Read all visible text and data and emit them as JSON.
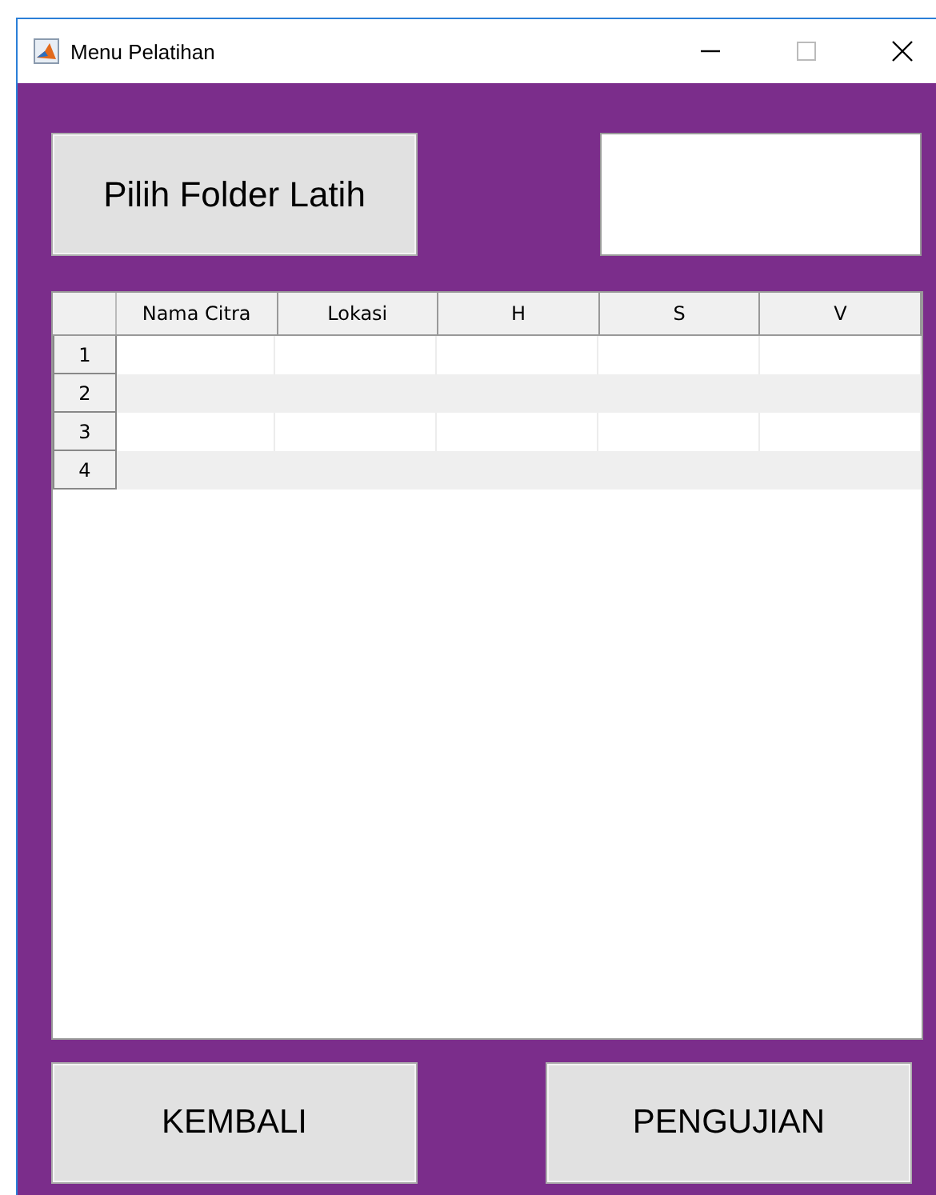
{
  "window": {
    "title": "Menu Pelatihan"
  },
  "folder_button": {
    "label": "Pilih Folder Latih"
  },
  "table": {
    "columns": [
      "Nama Citra",
      "Lokasi",
      "H",
      "S",
      "V"
    ],
    "rows": [
      {
        "label": "1"
      },
      {
        "label": "2"
      },
      {
        "label": "3"
      },
      {
        "label": "4"
      }
    ]
  },
  "buttons": [
    "KEMBALI",
    "PENGUJIAN"
  ]
}
